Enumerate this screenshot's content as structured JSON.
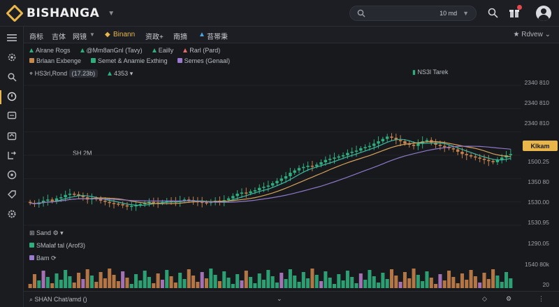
{
  "app": {
    "name": "BISHANGA"
  },
  "search": {
    "zoom": "10 md"
  },
  "menu": {
    "items": [
      "商标",
      "吉体",
      "网镜",
      "Binann",
      "资政+",
      "南摘",
      "苔帯秉"
    ],
    "review": "Rdvew"
  },
  "chart": {
    "legend1": [
      "Alrane Rogs",
      "@Mm8anGnl (Tavy)",
      "Eailly",
      "Rarl (Pard)"
    ],
    "legend2": [
      "Brlaan Exbenge",
      "Semet & Anamie Exthing",
      "Semes (Genaal)"
    ],
    "row3": {
      "label": "HS3rl,Rond",
      "badge": "(17.23b)",
      "vol": "4353"
    },
    "anno_top": "NS3l Tarek",
    "anno_left": "SH 2M",
    "price_labels": [
      "2340 810",
      "2340 810",
      "2340 810",
      "1500.25",
      "1350 80",
      "1530.00",
      "1530.95",
      "1290.05",
      "1540 80k",
      "20"
    ],
    "price_tag": "Klkam",
    "vol_label": "Sand",
    "sub_label": "SMalaf tal (Arof3)",
    "sub_sub": "Bam",
    "bottom_text": "SHAN Chat/amd ()"
  },
  "chart_data": {
    "type": "candlestick",
    "x": [
      1,
      2,
      3,
      4,
      5,
      6,
      7,
      8,
      9,
      10,
      11,
      12,
      13,
      14,
      15,
      16,
      17,
      18,
      19,
      20,
      21,
      22,
      23,
      24,
      25,
      26,
      27,
      28,
      29,
      30,
      31,
      32,
      33,
      34,
      35,
      36,
      37,
      38,
      39,
      40,
      41,
      42,
      43,
      44,
      45,
      46,
      47,
      48,
      49,
      50,
      51,
      52,
      53,
      54,
      55,
      56,
      57,
      58,
      59,
      60,
      61,
      62,
      63,
      64,
      65,
      66,
      67,
      68,
      69,
      70,
      71,
      72,
      73,
      74,
      75,
      76,
      77,
      78,
      79,
      80,
      81,
      82,
      83,
      84,
      85,
      86,
      87,
      88,
      89,
      90,
      91,
      92,
      93,
      94,
      95,
      96,
      97,
      98,
      99,
      100,
      101,
      102,
      103,
      104,
      105,
      106,
      107,
      108,
      109,
      110
    ],
    "open": [
      1400,
      1390,
      1380,
      1395,
      1410,
      1420,
      1405,
      1430,
      1440,
      1460,
      1470,
      1465,
      1450,
      1440,
      1420,
      1430,
      1425,
      1410,
      1400,
      1390,
      1385,
      1380,
      1370,
      1360,
      1365,
      1370,
      1380,
      1390,
      1400,
      1395,
      1390,
      1400,
      1410,
      1405,
      1400,
      1410,
      1420,
      1415,
      1405,
      1400,
      1395,
      1390,
      1400,
      1410,
      1405,
      1415,
      1430,
      1450,
      1470,
      1480,
      1475,
      1490,
      1500,
      1520,
      1530,
      1540,
      1560,
      1580,
      1600,
      1620,
      1650,
      1670,
      1690,
      1700,
      1710,
      1705,
      1720,
      1740,
      1760,
      1770,
      1780,
      1790,
      1800,
      1820,
      1830,
      1840,
      1860,
      1870,
      1880,
      1900,
      1920,
      1940,
      1960,
      1950,
      1930,
      1920,
      1900,
      1890,
      1880,
      1900,
      1920,
      1930,
      1910,
      1890,
      1880,
      1870,
      1860,
      1850,
      1830,
      1810,
      1800,
      1790,
      1780,
      1770,
      1760,
      1750,
      1740,
      1760,
      1780,
      1800
    ],
    "close": [
      1390,
      1380,
      1395,
      1410,
      1420,
      1405,
      1430,
      1440,
      1460,
      1470,
      1465,
      1450,
      1440,
      1420,
      1430,
      1425,
      1410,
      1400,
      1390,
      1385,
      1380,
      1370,
      1360,
      1365,
      1370,
      1380,
      1390,
      1400,
      1395,
      1390,
      1400,
      1410,
      1405,
      1400,
      1410,
      1420,
      1415,
      1405,
      1400,
      1395,
      1390,
      1400,
      1410,
      1405,
      1415,
      1430,
      1450,
      1470,
      1480,
      1475,
      1490,
      1500,
      1520,
      1530,
      1540,
      1560,
      1580,
      1600,
      1620,
      1650,
      1670,
      1690,
      1700,
      1710,
      1705,
      1720,
      1740,
      1760,
      1770,
      1780,
      1790,
      1800,
      1820,
      1830,
      1840,
      1860,
      1870,
      1880,
      1900,
      1920,
      1940,
      1960,
      1950,
      1930,
      1920,
      1900,
      1890,
      1880,
      1900,
      1920,
      1930,
      1910,
      1890,
      1880,
      1870,
      1860,
      1850,
      1830,
      1810,
      1800,
      1790,
      1780,
      1770,
      1760,
      1750,
      1740,
      1760,
      1780,
      1800,
      1810
    ],
    "ylim": [
      1200,
      2400
    ],
    "volume_ylim": [
      0,
      1
    ]
  }
}
